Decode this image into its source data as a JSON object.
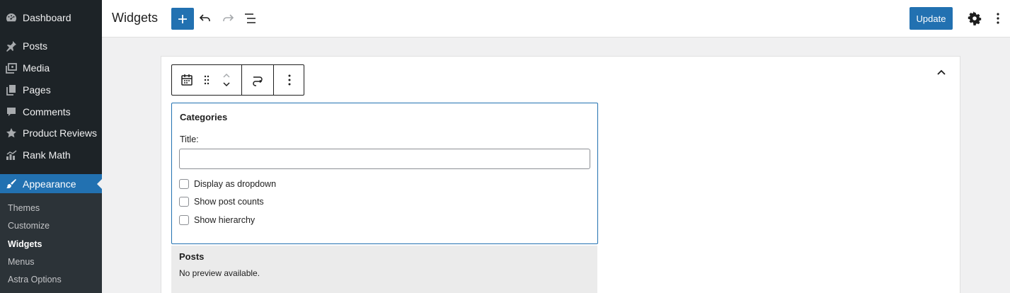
{
  "sidebar": {
    "items": [
      {
        "label": "Dashboard",
        "icon": "dashboard-icon"
      },
      {
        "label": "Posts",
        "icon": "pin-icon"
      },
      {
        "label": "Media",
        "icon": "media-icon"
      },
      {
        "label": "Pages",
        "icon": "pages-icon"
      },
      {
        "label": "Comments",
        "icon": "comments-icon"
      },
      {
        "label": "Product Reviews",
        "icon": "star-icon"
      },
      {
        "label": "Rank Math",
        "icon": "chart-icon"
      },
      {
        "label": "Appearance",
        "icon": "brush-icon"
      }
    ],
    "submenu": [
      "Themes",
      "Customize",
      "Widgets",
      "Menus",
      "Astra Options"
    ],
    "current_submenu": "Widgets"
  },
  "header": {
    "title": "Widgets",
    "update_label": "Update"
  },
  "widget": {
    "title": "Categories",
    "field_label": "Title:",
    "title_value": "",
    "options": [
      {
        "label": "Display as dropdown",
        "checked": false
      },
      {
        "label": "Show post counts",
        "checked": false
      },
      {
        "label": "Show hierarchy",
        "checked": false
      }
    ]
  },
  "posts_widget": {
    "title": "Posts",
    "note": "No preview available."
  },
  "colors": {
    "accent": "#2271b1",
    "sidebar_bg": "#1d2327",
    "submenu_bg": "#2c3338"
  }
}
